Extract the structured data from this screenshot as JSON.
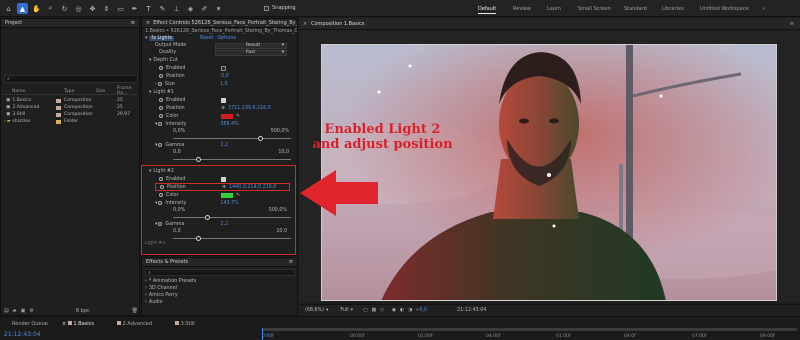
{
  "toolbar": {
    "icons": [
      "home-icon",
      "selection-tool-icon",
      "hand-tool-icon",
      "zoom-tool-icon",
      "rotate-tool-icon",
      "camera-orbit-icon",
      "pan-tool-icon",
      "dolly-tool-icon",
      "rectangle-tool-icon",
      "pen-tool-icon",
      "type-tool-icon",
      "brush-tool-icon",
      "clone-stamp-icon",
      "eraser-icon",
      "roto-brush-icon",
      "puppet-pin-icon"
    ],
    "snapping_label": "Snapping",
    "workspaces": [
      "Default",
      "Review",
      "Learn",
      "Small Screen",
      "Standard",
      "Libraries",
      "Untitled Workspace"
    ],
    "active_workspace": "Default",
    "more": "»"
  },
  "project": {
    "title": "Project",
    "search_placeholder": "",
    "columns": {
      "name": "Name",
      "type": "Type",
      "size": "Size",
      "frame_rate": "Frame Ra..."
    },
    "items": [
      {
        "name": "1.Basics",
        "type": "Compostion",
        "size": "",
        "frame_rate": "25",
        "color": "#c5a99e"
      },
      {
        "name": "2.Advanced",
        "type": "Composition",
        "size": "",
        "frame_rate": "25",
        "color": "#c5a99e"
      },
      {
        "name": "3.Still",
        "type": "Composition",
        "size": "",
        "frame_rate": "29,97",
        "color": "#c5a99e"
      },
      {
        "name": "shizzles",
        "type": "Folder",
        "size": "",
        "frame_rate": "",
        "color": "#d6b35a"
      }
    ],
    "bpc": "8 bpc"
  },
  "effect_controls": {
    "tab_title": "Effect Controls 526128_Serious_Face_Portrait_Staring_By_Th",
    "breadcrumb": "1.Basics • 526128_Serious_Face_Portrait_Staring_By_Thomas_Gellert_Ar",
    "effect_name": "fx Lights",
    "reset": "Reset",
    "options": "Options",
    "output_mode_label": "Output Mode",
    "output_mode_value": "Result",
    "quality_label": "Quality",
    "quality_value": "Fast",
    "depth_cut_label": "Depth Cut",
    "enabled_label": "Enabled",
    "position_label": "Position",
    "size_label": "Size",
    "depth_position_value": "0,0",
    "depth_size_value": "1,0",
    "light1": {
      "label": "Light #1",
      "position_value": "3711,139,6,216,0",
      "color_label": "Color",
      "intensity_label": "Intensity",
      "intensity_value": "369,4%",
      "range_min": "0,0%",
      "range_max": "500,0%",
      "intensity_fraction": 0.74,
      "gamma_label": "Gamma",
      "gamma_value": "2,2",
      "gamma_min": "0,0",
      "gamma_max": "10,0",
      "gamma_fraction": 0.22,
      "color_hex": "#d21d1d"
    },
    "light2": {
      "label": "Light #2",
      "position_value": "1440,0,214,0,216,0",
      "color_label": "Color",
      "intensity_label": "Intensity",
      "intensity_value": "143,7%",
      "range_min": "0,0%",
      "range_max": "500,0%",
      "intensity_fraction": 0.29,
      "gamma_label": "Gamma",
      "gamma_value": "2,2",
      "gamma_min": "0,0",
      "gamma_max": "10,0",
      "gamma_fraction": 0.22,
      "color_hex": "#2fd23a"
    },
    "light3_label": "Light #3"
  },
  "effects_presets": {
    "title": "Effects & Presets",
    "items": [
      "* Animation Presets",
      "3D Channel",
      "Amico Perry",
      "Audio"
    ]
  },
  "composition": {
    "tab_title": "Composition 1.Basics",
    "sub_tab": "1.Basics",
    "zoom": "(68,6%)",
    "quality": "Full",
    "exposure": "+0,0",
    "timecode": "21:12:43:04"
  },
  "annotation": {
    "line1": "Enabled Light 2",
    "line2": "and adjust position",
    "color": "#d8202a"
  },
  "bottom": {
    "render_queue": "Render Queue",
    "tabs": [
      "1.Basics",
      "2.Advanced",
      "3.Still"
    ],
    "timecode": "21:12:43:04",
    "ruler": [
      "0:00f",
      "00:00f",
      "01:00f",
      "04:00f",
      "01:00f",
      "04:0f",
      "07:00f",
      "09:00f"
    ]
  }
}
